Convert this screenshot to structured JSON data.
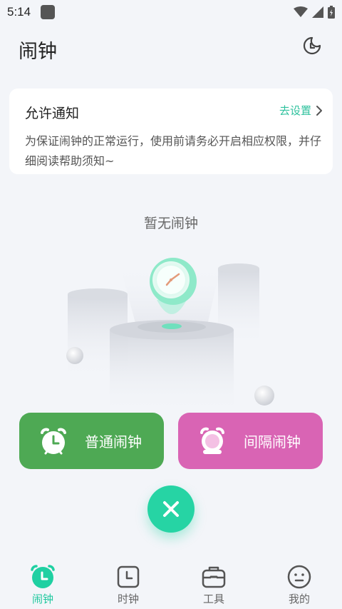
{
  "status_bar": {
    "time": "5:14"
  },
  "header": {
    "title": "闹钟",
    "moon_icon": "moon-clock-icon"
  },
  "notice": {
    "title": "允许通知",
    "link_label": "去设置",
    "text": "为保证闹钟的正常运行，使用前请务必开启相应权限，并仔细阅读帮助须知~"
  },
  "empty_state": {
    "text": "暂无闹钟"
  },
  "buttons": {
    "normal_alarm": "普通闹钟",
    "interval_alarm": "间隔闹钟"
  },
  "tabs": [
    {
      "label": "闹钟",
      "icon": "alarm-icon",
      "active": true
    },
    {
      "label": "时钟",
      "icon": "clock-icon",
      "active": false
    },
    {
      "label": "工具",
      "icon": "toolbox-icon",
      "active": false
    },
    {
      "label": "我的",
      "icon": "face-icon",
      "active": false
    }
  ],
  "colors": {
    "accent": "#26d4a4",
    "normal_button": "#4ea954",
    "interval_button": "#d964b4",
    "background": "#f3f5f9"
  }
}
